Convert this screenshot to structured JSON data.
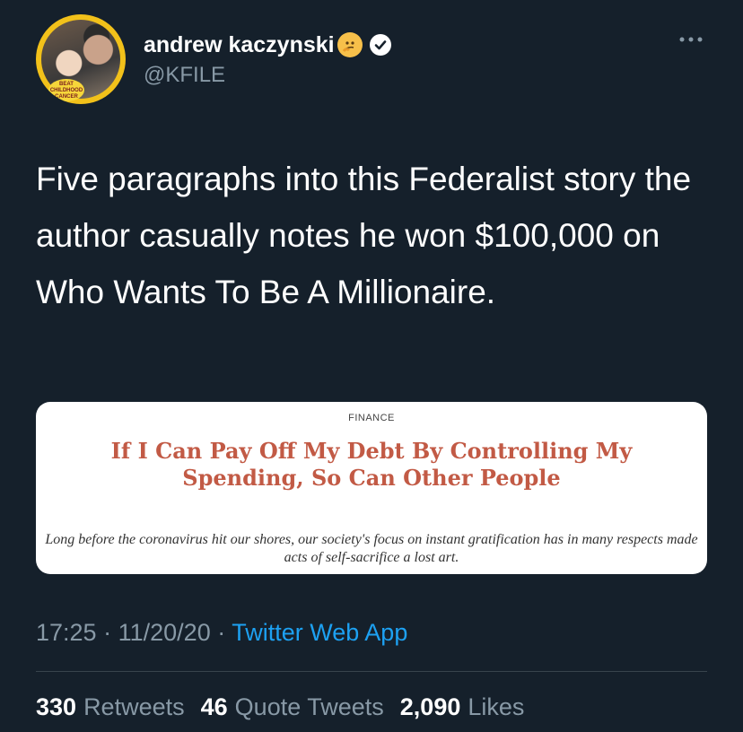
{
  "author": {
    "name": "andrew kaczynski",
    "handle": "@KFILE",
    "avatar_badge": "BEAT CHILDHOOD CANCER"
  },
  "tweet": {
    "text": "Five paragraphs into this Federalist story the author casually notes he won $100,000 on Who Wants To Be A Millionaire."
  },
  "card": {
    "section": "FINANCE",
    "title": "If I Can Pay Off My Debt By Controlling My Spending, So Can Other People",
    "description": "Long before the coronavirus hit our shores, our society's focus on instant gratification has in many respects made acts of self-sacrifice a lost art."
  },
  "meta": {
    "time": "17:25",
    "date": "11/20/20",
    "source": "Twitter Web App",
    "separator": "·"
  },
  "stats": {
    "retweets_count": "330",
    "retweets_label": "Retweets",
    "quotes_count": "46",
    "quotes_label": "Quote Tweets",
    "likes_count": "2,090",
    "likes_label": "Likes"
  },
  "icons": {
    "emoji": "thinking-face-icon",
    "verified": "verified-badge-icon",
    "more": "more-options-icon"
  },
  "colors": {
    "background": "#15202b",
    "secondary_text": "#8899a6",
    "link": "#1da1f2",
    "card_title": "#c25a45"
  }
}
